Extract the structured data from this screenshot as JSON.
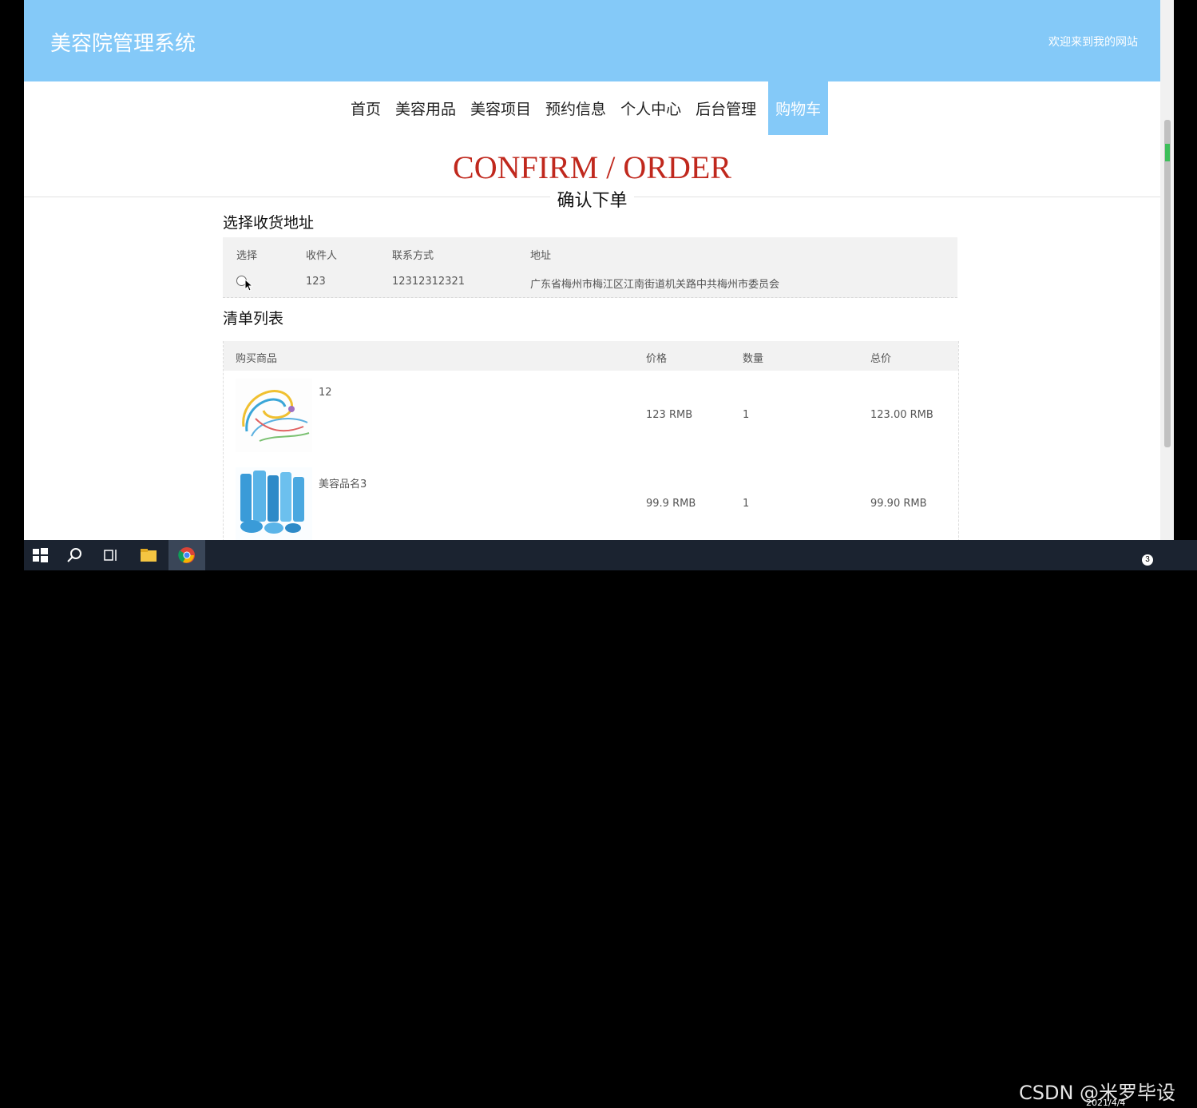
{
  "header": {
    "site_title": "美容院管理系统",
    "welcome": "欢迎来到我的网站"
  },
  "nav": {
    "items": [
      "首页",
      "美容用品",
      "美容项目",
      "预约信息",
      "个人中心",
      "后台管理"
    ],
    "active": "购物车"
  },
  "hero": {
    "title": "CONFIRM / ORDER",
    "subtitle": "确认下单"
  },
  "address_section": {
    "heading": "选择收货地址",
    "columns": [
      "选择",
      "收件人",
      "联系方式",
      "地址"
    ],
    "rows": [
      {
        "recipient": "123",
        "phone": "12312312321",
        "address": "广东省梅州市梅江区江南街道机关路中共梅州市委员会"
      }
    ]
  },
  "list_section": {
    "heading": "清单列表",
    "columns": [
      "购买商品",
      "价格",
      "数量",
      "总价"
    ],
    "rows": [
      {
        "name": "12",
        "price": "123 RMB",
        "qty": "1",
        "total": "123.00 RMB",
        "image": "swirl-art-image"
      },
      {
        "name": "美容品名3",
        "price": "99.9 RMB",
        "qty": "1",
        "total": "99.90 RMB",
        "image": "skincare-products-image"
      }
    ]
  },
  "taskbar": {
    "watermark": "CSDN @米罗毕设",
    "date": "2021/4/4",
    "notification_count": "3"
  }
}
